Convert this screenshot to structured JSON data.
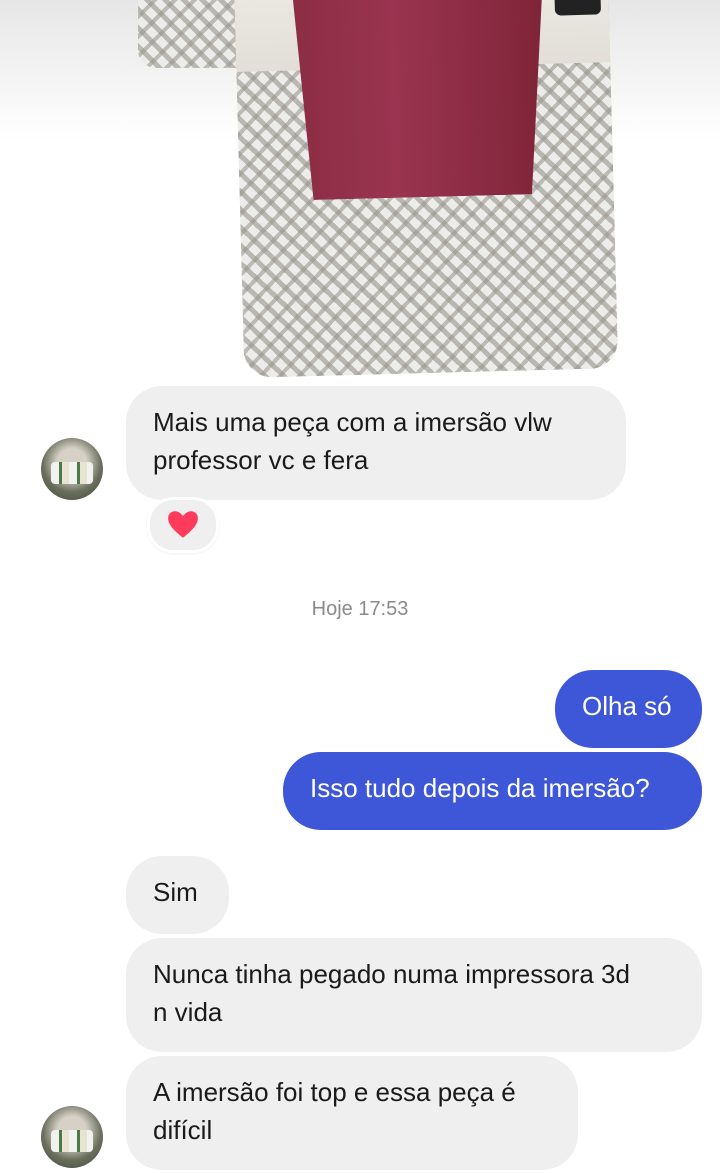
{
  "conversation": {
    "attachments": [
      {
        "type": "photo",
        "icon": "photo-thumbnail"
      },
      {
        "type": "photo",
        "icon": "photo-red-vase-on-rug"
      }
    ],
    "messages": [
      {
        "sender": "contact",
        "text": "Mais uma peça com a imersão  vlw\nprofessor  vc e fera"
      },
      {
        "sender": "me",
        "text": "Olha só"
      },
      {
        "sender": "me",
        "text": "Isso tudo depois da imersão?"
      },
      {
        "sender": "contact",
        "text": "Sim"
      },
      {
        "sender": "contact",
        "text": "Nunca tinha pegado numa impressora  3d\nn vida"
      },
      {
        "sender": "contact",
        "text": "A imersão foi top e essa peça é\ndifícil"
      }
    ],
    "reaction": {
      "emoji": "heart",
      "color": "#ff3b5c"
    },
    "timestamp": "Hoje 17:53"
  },
  "colors": {
    "incoming_bubble": "#efefef",
    "outgoing_bubble": "#3e57d8",
    "timestamp_text": "#8a8a8a"
  }
}
